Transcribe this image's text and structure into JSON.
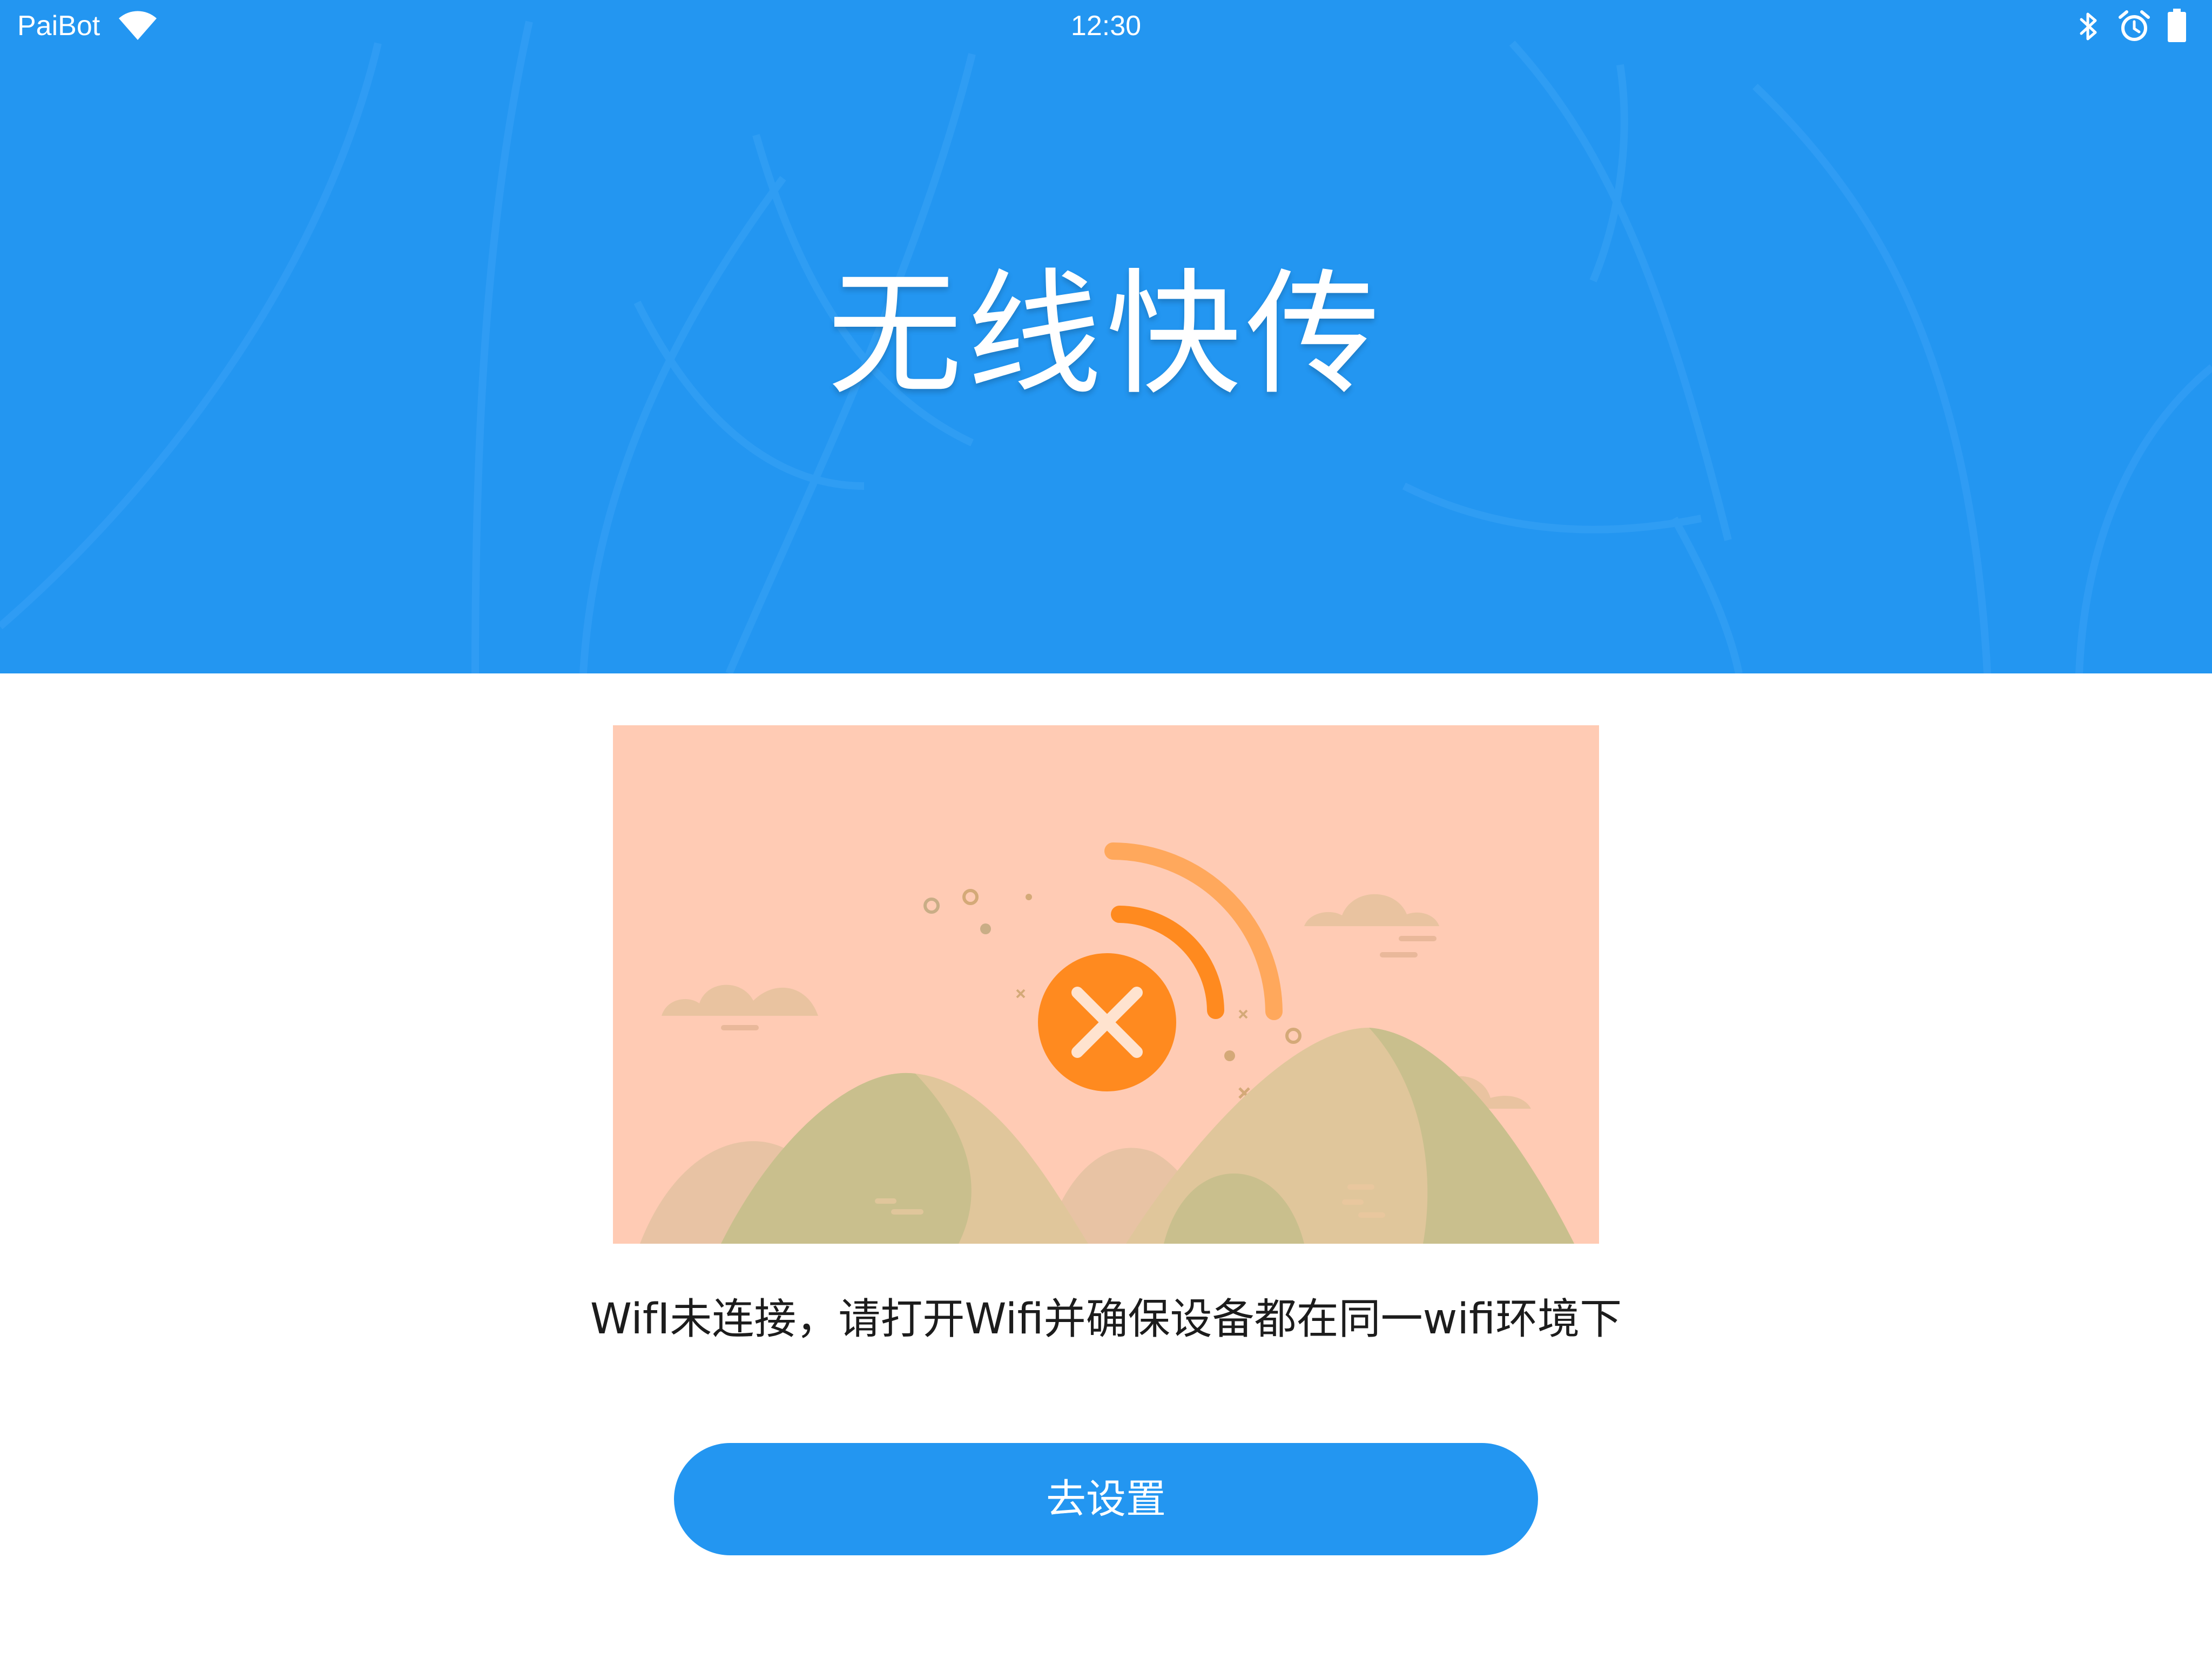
{
  "status_bar": {
    "carrier": "PaiBot",
    "time": "12:30",
    "icons": [
      "wifi-icon",
      "bluetooth-icon",
      "alarm-icon",
      "battery-icon"
    ]
  },
  "header": {
    "title": "无线快传",
    "background_color": "#2396f1"
  },
  "illustration": {
    "icon": "wifi-disconnected-icon",
    "background_color": "#ffcbb4",
    "accent_color": "#ff8a1f"
  },
  "message": "WifI未连接，请打开Wifi并确保设备都在同一wifi环境下",
  "actions": {
    "settings_label": "去设置",
    "button_color": "#2396f1"
  }
}
